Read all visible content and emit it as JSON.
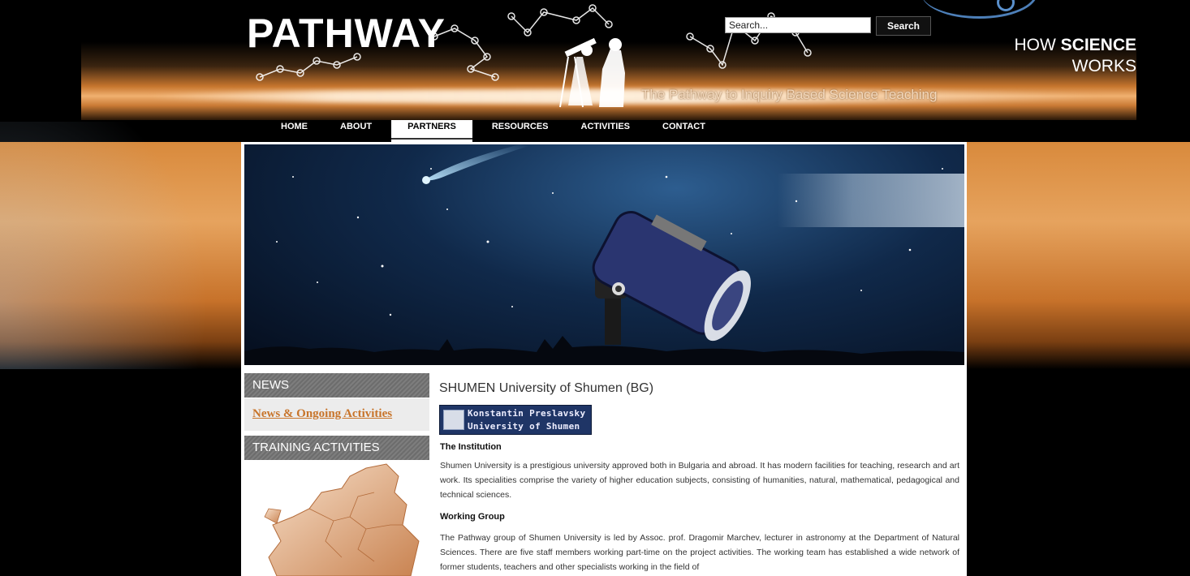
{
  "header": {
    "logo": "PATHWAY",
    "tagline": "The Pathway to Inquiry Based Science Teaching",
    "search_placeholder": "Search...",
    "search_button": "Search"
  },
  "nav": [
    "HOME",
    "ABOUT",
    "PARTNERS",
    "RESOURCES",
    "ACTIVITIES",
    "CONTACT"
  ],
  "nav_active": "PARTNERS",
  "hero": {
    "line1_prefix": "HOW ",
    "line1_bold": "SCIENCE",
    "line2": "WORKS"
  },
  "sidebar": {
    "news_heading": "NEWS",
    "news_link": "News & Ongoing Activities",
    "training_heading": "TRAINING ACTIVITIES"
  },
  "main": {
    "title": "SHUMEN University of Shumen (BG)",
    "logo_line1": "Konstantin Preslavsky",
    "logo_line2": "University of Shumen",
    "institution_heading": "The Institution",
    "institution_text": "Shumen University is a prestigious university approved both in Bulgaria and abroad. It has modern facilities for teaching, research and art work. Its specialities comprise the variety of higher education subjects, consisting of humanities, natural, mathematical, pedagogical and technical sciences.",
    "working_heading": "Working Group",
    "working_text": "The Pathway group of Shumen University is led by Assoc. prof. Dragomir Marchev, lecturer in astronomy at the Department of Natural Sciences. There are five staff members working part-time on the project activities. The working team has established a wide network of former students, teachers and other specialists working in the field of"
  },
  "colors": {
    "accent_orange": "#d98a3c",
    "link_orange": "#c8742a",
    "sidebar_grey": "#6d6d6d"
  }
}
